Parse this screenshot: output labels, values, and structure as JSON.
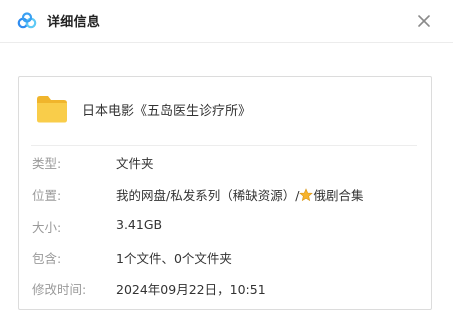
{
  "header": {
    "title": "详细信息",
    "logo_icon": "cloud-logo-icon",
    "close_icon": "close-icon"
  },
  "file": {
    "icon": "folder-icon",
    "name": "日本电影《五岛医生诊疗所》"
  },
  "details": [
    {
      "label": "类型:",
      "value": "文件夹"
    },
    {
      "label": "位置:",
      "value_prefix": "我的网盘/私发系列（稀缺资源）/",
      "value_icon": "star-icon",
      "value_suffix": "俄剧合集"
    },
    {
      "label": "大小:",
      "value": "3.41GB"
    },
    {
      "label": "包含:",
      "value": "1个文件、0个文件夹"
    },
    {
      "label": "修改时间:",
      "value": "2024年09月22日，10:51"
    }
  ],
  "colors": {
    "folder": "#f5c342",
    "star": "#f7b32b",
    "logo_blue": "#2f8cf0",
    "logo_cyan": "#5ec9f5"
  }
}
